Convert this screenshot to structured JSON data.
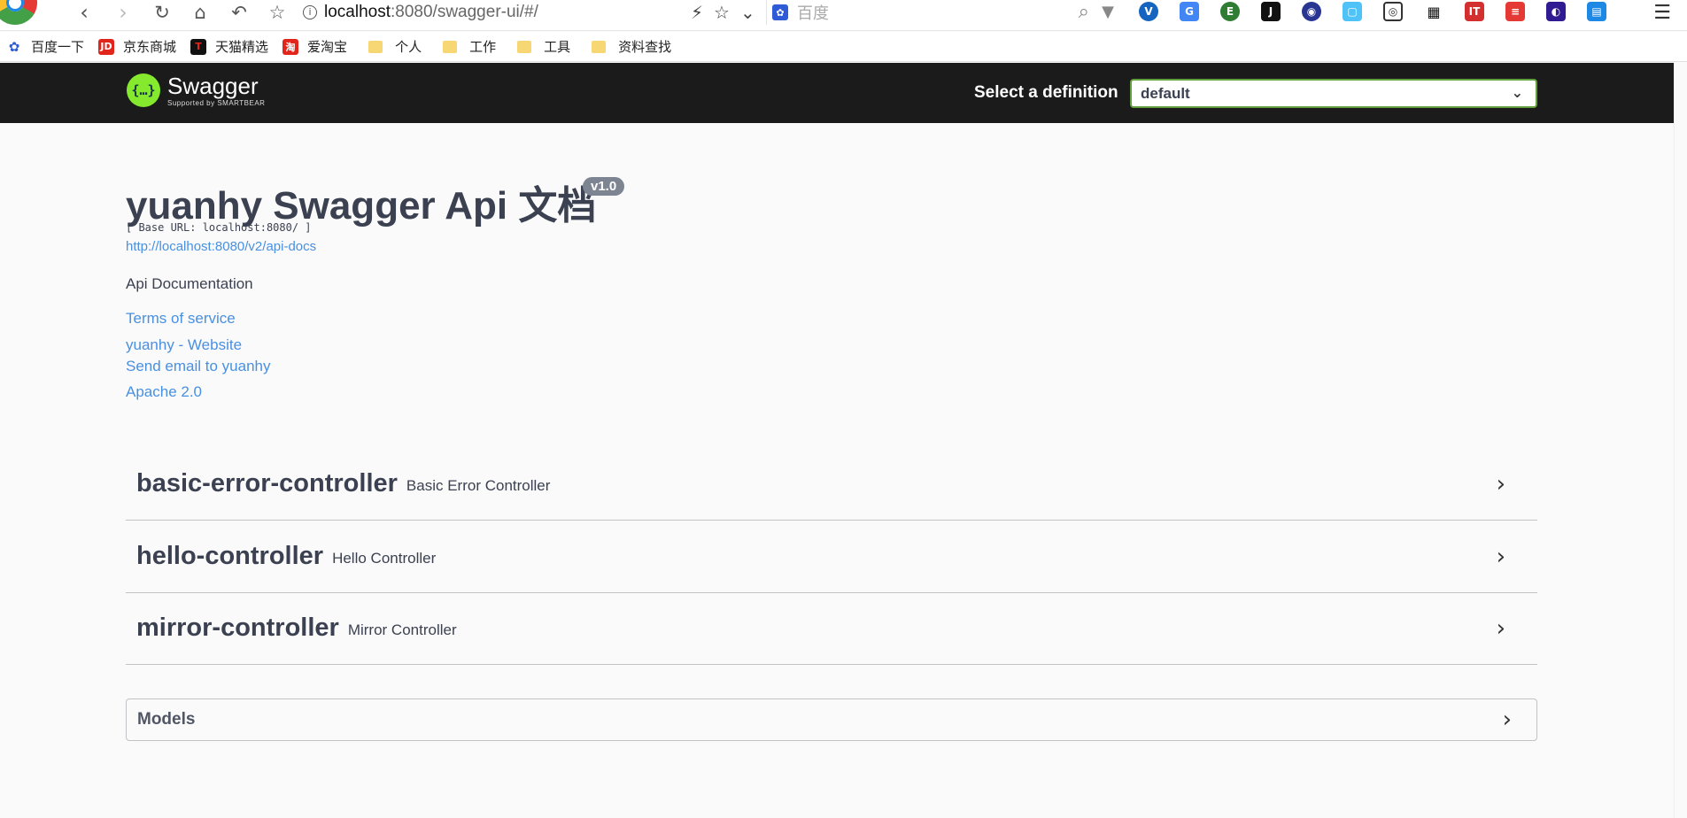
{
  "browser": {
    "url_host": "localhost",
    "url_path": ":8080/swagger-ui/#/",
    "search_placeholder": "百度"
  },
  "bookmarks": [
    {
      "label": "百度一下",
      "icon": "baidu-paw-icon",
      "color": "#2f5cd6",
      "glyph": "✿"
    },
    {
      "label": "京东商城",
      "icon": "jd-icon",
      "color": "#e1251b",
      "glyph": "JD"
    },
    {
      "label": "天猫精选",
      "icon": "tmall-icon",
      "color": "#111111",
      "glyph": "T"
    },
    {
      "label": "爱淘宝",
      "icon": "taobao-icon",
      "color": "#e1251b",
      "glyph": "淘"
    },
    {
      "label": "个人",
      "icon": "folder-icon"
    },
    {
      "label": "工作",
      "icon": "folder-icon"
    },
    {
      "label": "工具",
      "icon": "folder-icon"
    },
    {
      "label": "资料查找",
      "icon": "folder-icon"
    }
  ],
  "swagger": {
    "logo_name": "Swagger",
    "logo_sub": "Supported by SMARTBEAR",
    "definition_label": "Select a definition",
    "definition_value": "default"
  },
  "info": {
    "title": "yuanhy Swagger Api 文档",
    "version": "v1.0",
    "base_url": "[ Base URL: localhost:8080/ ]",
    "api_docs_link": "http://localhost:8080/v2/api-docs",
    "description": "Api Documentation",
    "terms": "Terms of service",
    "website": "yuanhy - Website",
    "email": "Send email to yuanhy",
    "license": "Apache 2.0"
  },
  "controllers": [
    {
      "name": "basic-error-controller",
      "description": "Basic Error Controller"
    },
    {
      "name": "hello-controller",
      "description": "Hello Controller"
    },
    {
      "name": "mirror-controller",
      "description": "Mirror Controller"
    }
  ],
  "models": {
    "label": "Models"
  },
  "colors": {
    "accent_green": "#85ea2d",
    "link": "#4990e2",
    "topbar": "#1b1b1b",
    "text": "#3b4151"
  }
}
